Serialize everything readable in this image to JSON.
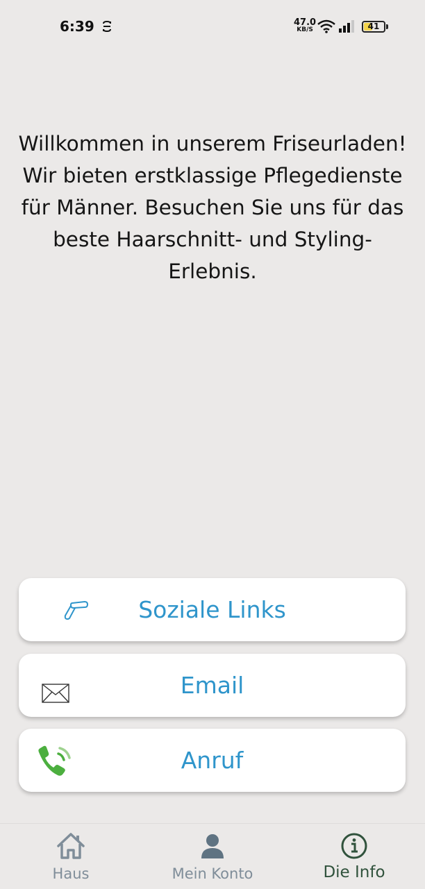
{
  "status_bar": {
    "time": "6:39",
    "net_speed_value": "47.0",
    "net_speed_unit": "KB/S",
    "battery_level": "41",
    "battery_fraction": 0.41,
    "icons": [
      "sync-icon",
      "wifi-icon",
      "signal-icon",
      "battery-icon"
    ]
  },
  "welcome_text": "Willkommen in unserem Friseurladen! Wir bieten erstklassige Pflegedienste für Männer. Besuchen Sie uns für das beste Haarschnitt- und Styling-Erlebnis.",
  "actions": {
    "social_label": "Soziale Links",
    "email_label": "Email",
    "call_label": "Anruf"
  },
  "nav": {
    "home_label": "Haus",
    "account_label": "Mein Konto",
    "info_label": "Die Info",
    "active": "info"
  },
  "colors": {
    "background": "#ebe9e8",
    "accent_blue": "#2f95cb",
    "phone_green": "#4caf3f",
    "nav_inactive": "#7f8d99",
    "nav_active": "#30523c"
  }
}
